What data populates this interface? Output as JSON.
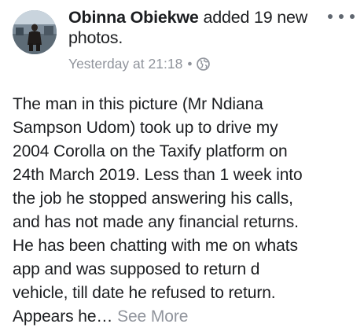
{
  "post": {
    "author": "Obinna Obiekwe",
    "action": "added 19 new photos.",
    "timestamp": "Yesterday at 21:18",
    "separator": "•",
    "audience_icon": "globe-icon",
    "more_icon": "more-options-icon",
    "body_lines": [
      "The man in this picture (Mr Ndiana",
      "Sampson Udom) took up to drive my",
      "2004 Corolla on the Taxify platform on",
      "24th March 2019. Less than 1 week into",
      "the job he stopped answering his calls,",
      "and has not made any financial returns.",
      "He has been chatting with me on whats",
      "app and was supposed to return d",
      "vehicle, till date he refused to return."
    ],
    "last_line": "Appears he…",
    "see_more": "See More"
  },
  "colors": {
    "text": "#1c1e21",
    "secondary": "#90949c",
    "icon": "#606770"
  }
}
